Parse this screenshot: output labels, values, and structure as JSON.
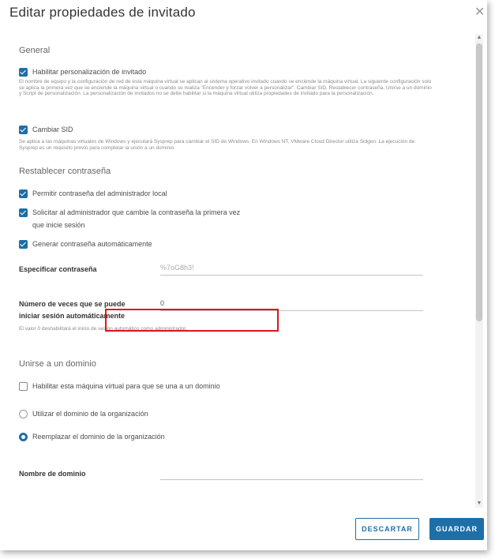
{
  "dialog": {
    "title": "Editar propiedades de invitado",
    "close_icon": "close-icon"
  },
  "general": {
    "heading": "General",
    "enable_customization_label": "Habilitar personalización de invitado",
    "enable_customization_checked": true,
    "customization_help": "El nombre de equipo y la configuración de red de esta máquina virtual se aplican al sistema operativo invitado cuando se enciende la máquina virtual. La siguiente configuración solo se aplica la primera vez que se enciende la máquina virtual o cuando se realiza \"Encender y forzar volver a personalizar\". Cambiar SID, Restablecer contraseña, Unirse a un dominio y Script de personalización. La personalización de invitados no se debe habilitar si la máquina virtual utiliza propiedades de invitado para la personalización.",
    "change_sid_label": "Cambiar SID",
    "change_sid_checked": true,
    "change_sid_help": "Se aplica a las máquinas virtuales de Windows y ejecutará Sysprep para cambiar el SID de Windows. En Windows NT, VMware Cloud Director utiliza Sidgen. La ejecución de Sysprep es un requisito previo para completar la unión a un dominio."
  },
  "password": {
    "heading": "Restablecer contraseña",
    "allow_local_admin_label": "Permitir contraseña del administrador local",
    "allow_local_admin_checked": true,
    "require_change_label_1": "Solicitar al administrador que cambie la contraseña la primera vez",
    "require_change_label_2": "que inicie sesión",
    "require_change_checked": true,
    "auto_generate_label": "Generar contraseña automáticamente",
    "auto_generate_checked": true,
    "specify_label": "Especificar contraseña",
    "specify_value": "%7oG8h3!",
    "autologon_label_1": "Número de veces que se puede",
    "autologon_label_2": "iniciar sesión automáticamente",
    "autologon_value": "0",
    "autologon_help": "El valor 0 deshabilitará el inicio de sesión automático como administrador."
  },
  "domain": {
    "heading": "Unirse a un dominio",
    "enable_join_label": "Habilitar esta máquina virtual para que se una a un dominio",
    "enable_join_checked": false,
    "use_org_label": "Utilizar el dominio de la organización",
    "override_org_label": "Reemplazar el dominio de la organización",
    "selected_option": "override",
    "domain_name_label": "Nombre de dominio",
    "domain_name_value": ""
  },
  "footer": {
    "cancel_label": "DESCARTAR",
    "save_label": "GUARDAR"
  },
  "colors": {
    "accent": "#1e6fa8",
    "highlight": "#e0141a"
  }
}
